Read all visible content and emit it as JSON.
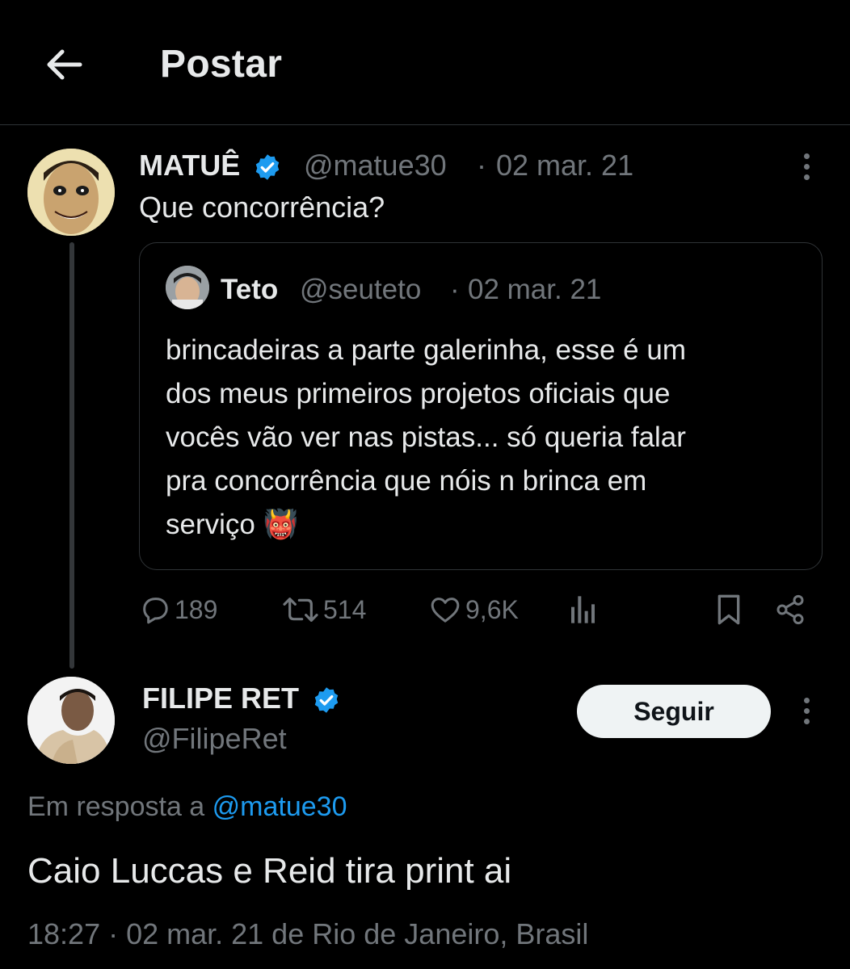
{
  "header": {
    "title": "Postar"
  },
  "tweet": {
    "name": "MATUÊ",
    "handle": "@matue30",
    "separator": "·",
    "date": "02 mar. 21",
    "text": "Que concorrência?",
    "quote": {
      "name": "Teto",
      "handle": "@seuteto",
      "separator": "·",
      "date": "02 mar. 21",
      "lines": [
        "brincadeiras a parte galerinha, esse é um",
        "dos meus primeiros projetos oficiais que",
        "vocês vão ver nas pistas... só queria falar",
        "pra concorrência que nóis n brinca em",
        "serviço 👹"
      ]
    },
    "actions": {
      "replies": "189",
      "reposts": "514",
      "likes": "9,6K"
    }
  },
  "reply": {
    "name": "FILIPE RET",
    "handle": "@FilipeRet",
    "follow_label": "Seguir",
    "reply_prefix": "Em resposta a",
    "reply_handle": "@matue30",
    "text": "Caio Luccas e Reid tira print ai",
    "meta": "18:27 · 02 mar. 21 de Rio de Janeiro, Brasil"
  },
  "colors": {
    "background": "#000000",
    "text": "#e7e9ea",
    "muted": "#71767b",
    "accent": "#1d9bf0",
    "verified": "#1d9bf0",
    "border": "#2f3336"
  },
  "icons": {
    "back": "arrow-left-icon",
    "verified": "verified-badge-icon",
    "more": "more-vertical-icon",
    "reply": "reply-icon",
    "repost": "repost-icon",
    "like": "heart-icon",
    "views": "views-chart-icon",
    "bookmark": "bookmark-icon",
    "share": "share-icon"
  }
}
